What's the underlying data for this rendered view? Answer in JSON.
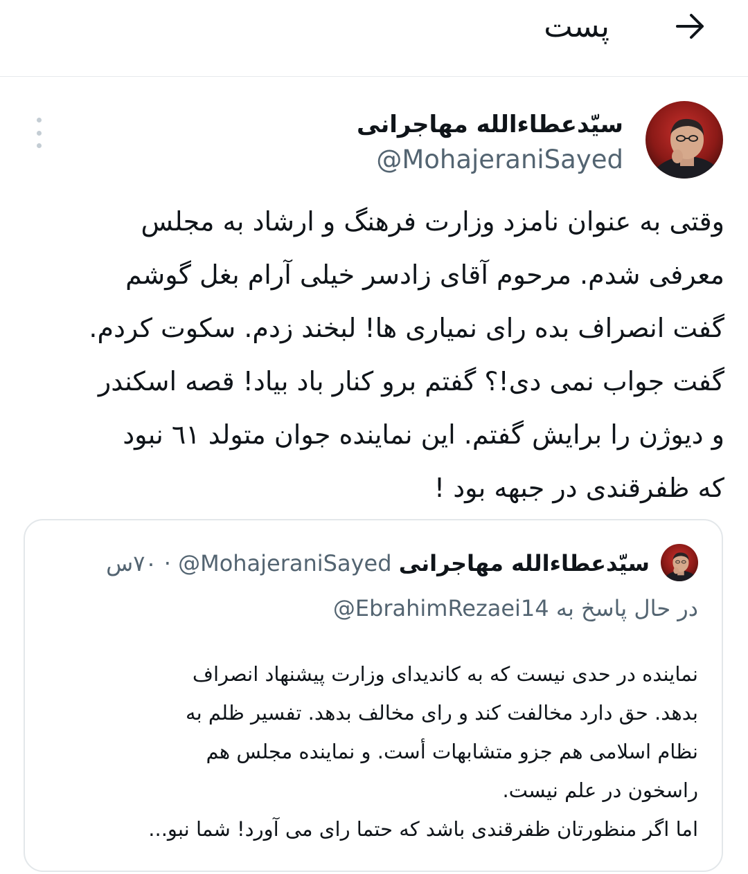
{
  "header": {
    "title": "پست",
    "back_icon": "arrow-right-icon"
  },
  "tweet": {
    "author_name": "سیّدعطاءالله مهاجرانی",
    "author_handle": "@MohajeraniSayed",
    "more_icon": "vertical-dots-icon",
    "lines": [
      "وقتی به عنوان نامزد وزارت فرهنگ و ارشاد به مجلس",
      "معرفی شدم. مرحوم آقای زادسر خیلی آرام بغل گوشم",
      "گفت انصراف بده رای نمیاری ها! لبخند زدم. سکوت کردم.",
      "گفت جواب نمی دی!؟ گفتم برو کنار باد بیاد! قصه اسکندر",
      "و دیوژن را برایش گفتم. این نماینده جوان متولد ٦١ نبود",
      "که ظفرقندی در جبهه بود !"
    ]
  },
  "quote": {
    "author_name": "سیّدعطاءالله مهاجرانی",
    "author_handle": "@MohajeraniSayed",
    "separator": "·",
    "time": "۷۰س",
    "reply_prefix": "در حال پاسخ به",
    "reply_handle": "@EbrahimRezaei14",
    "lines": [
      "نماینده در حدی نیست که به کاندیدای وزارت پیشنهاد انصراف",
      "بدهد. حق دارد مخالفت کند و رای مخالف بدهد. تفسیر ظلم به",
      "نظام اسلامی هم جزو متشابهات أست. و نماینده مجلس هم",
      "راسخون در علم نیست.",
      "اما اگر منظورتان ظفرقندی باشد که حتما رای می آورد! شما نبو..."
    ]
  },
  "colors": {
    "text": "#0f1419",
    "secondary": "#536471",
    "border": "#e3e7ea"
  }
}
